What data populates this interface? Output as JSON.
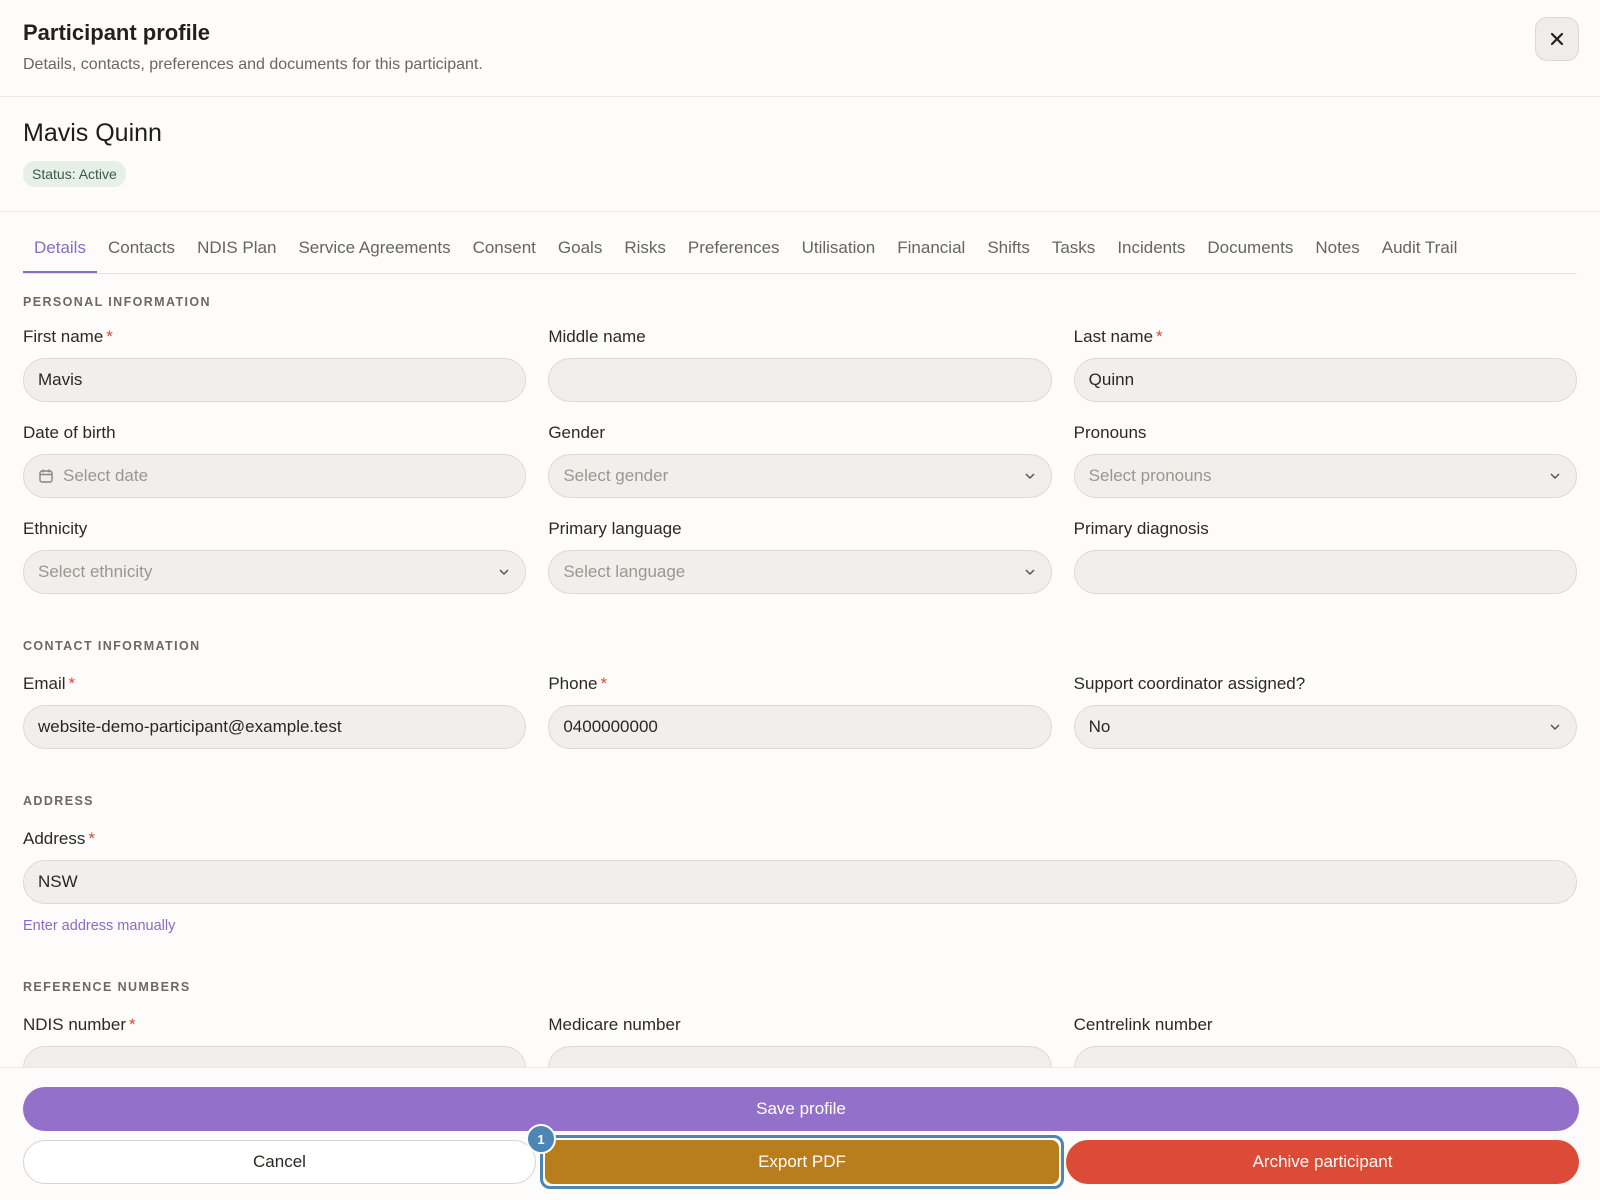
{
  "header": {
    "title": "Participant profile",
    "subtitle": "Details, contacts, preferences and documents for this participant.",
    "close_icon": "close-icon"
  },
  "participant": {
    "name": "Mavis Quinn",
    "status": "Status: Active"
  },
  "tabs": [
    {
      "label": "Details",
      "active": true
    },
    {
      "label": "Contacts"
    },
    {
      "label": "NDIS Plan"
    },
    {
      "label": "Service Agreements"
    },
    {
      "label": "Consent"
    },
    {
      "label": "Goals"
    },
    {
      "label": "Risks"
    },
    {
      "label": "Preferences"
    },
    {
      "label": "Utilisation"
    },
    {
      "label": "Financial"
    },
    {
      "label": "Shifts"
    },
    {
      "label": "Tasks"
    },
    {
      "label": "Incidents"
    },
    {
      "label": "Documents"
    },
    {
      "label": "Notes"
    },
    {
      "label": "Audit Trail"
    }
  ],
  "personal": {
    "section_title": "PERSONAL INFORMATION",
    "first_name": {
      "label": "First name",
      "value": "Mavis"
    },
    "middle_name": {
      "label": "Middle name",
      "value": ""
    },
    "last_name": {
      "label": "Last name",
      "value": "Quinn"
    },
    "dob": {
      "label": "Date of birth",
      "placeholder": "Select date"
    },
    "gender": {
      "label": "Gender",
      "placeholder": "Select gender"
    },
    "pronouns": {
      "label": "Pronouns",
      "placeholder": "Select pronouns"
    },
    "ethnicity": {
      "label": "Ethnicity",
      "placeholder": "Select ethnicity"
    },
    "language": {
      "label": "Primary language",
      "placeholder": "Select language"
    },
    "diagnosis": {
      "label": "Primary diagnosis",
      "value": ""
    }
  },
  "contact": {
    "section_title": "CONTACT INFORMATION",
    "email": {
      "label": "Email",
      "value": "website-demo-participant@example.test"
    },
    "phone": {
      "label": "Phone",
      "value": "0400000000"
    },
    "coordinator": {
      "label": "Support coordinator assigned?",
      "value": "No"
    }
  },
  "address": {
    "section_title": "ADDRESS",
    "label": "Address",
    "value": "NSW",
    "manual_link": "Enter address manually"
  },
  "reference": {
    "section_title": "REFERENCE NUMBERS",
    "ndis": {
      "label": "NDIS number"
    },
    "medicare": {
      "label": "Medicare number"
    },
    "centrelink": {
      "label": "Centrelink number"
    }
  },
  "required_marker": "*",
  "footer": {
    "save_label": "Save profile",
    "cancel_label": "Cancel",
    "export_label": "Export PDF",
    "archive_label": "Archive participant",
    "step_badge": "1"
  },
  "colors": {
    "accent": "#8b6bc7",
    "save": "#9370c9",
    "export": "#b87d1d",
    "archive": "#dc4b37",
    "highlight": "#4c86b5"
  }
}
